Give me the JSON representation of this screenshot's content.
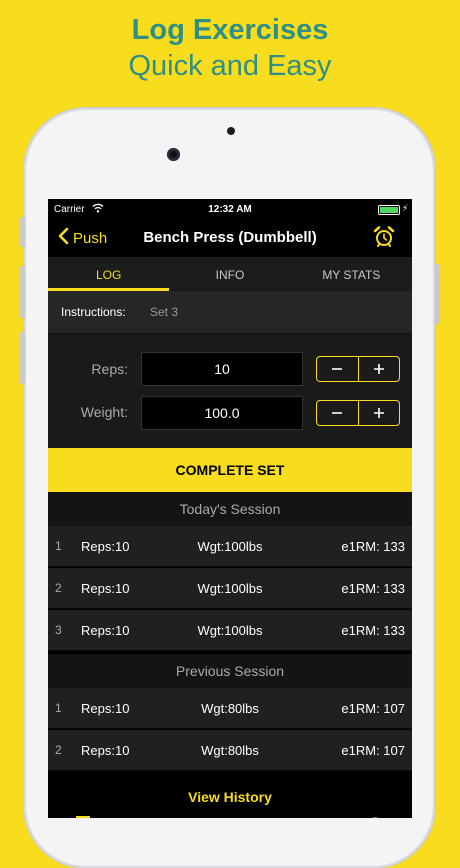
{
  "promo": {
    "headline": "Log Exercises",
    "subheadline": "Quick and Easy"
  },
  "status_bar": {
    "carrier": "Carrier",
    "time": "12:32 AM"
  },
  "nav": {
    "back_label": "Push",
    "title": "Bench Press (Dumbbell)"
  },
  "tabs": [
    {
      "label": "LOG"
    },
    {
      "label": "INFO"
    },
    {
      "label": "MY STATS"
    }
  ],
  "instructions": {
    "label": "Instructions:",
    "value": "Set 3"
  },
  "inputs": {
    "reps": {
      "label": "Reps:",
      "value": "10"
    },
    "weight": {
      "label": "Weight:",
      "value": "100.0"
    }
  },
  "complete_button": "COMPLETE SET",
  "today_session": {
    "title": "Today's Session",
    "sets": [
      {
        "num": "1",
        "reps": "Reps:10",
        "weight": "Wgt:100lbs",
        "e1rm": "e1RM: 133"
      },
      {
        "num": "2",
        "reps": "Reps:10",
        "weight": "Wgt:100lbs",
        "e1rm": "e1RM: 133"
      },
      {
        "num": "3",
        "reps": "Reps:10",
        "weight": "Wgt:100lbs",
        "e1rm": "e1RM: 133"
      }
    ]
  },
  "previous_session": {
    "title": "Previous Session",
    "sets": [
      {
        "num": "1",
        "reps": "Reps:10",
        "weight": "Wgt:80lbs",
        "e1rm": "e1RM: 107"
      },
      {
        "num": "2",
        "reps": "Reps:10",
        "weight": "Wgt:80lbs",
        "e1rm": "e1RM: 107"
      }
    ]
  },
  "view_history": "View History",
  "colors": {
    "accent": "#f7dd1e",
    "headline": "#2f8f86",
    "background": "#f7dd1e"
  },
  "icons": [
    "wifi-icon",
    "battery-icon",
    "chevron-left-icon",
    "alarm-clock-icon",
    "minus-icon",
    "plus-icon"
  ]
}
